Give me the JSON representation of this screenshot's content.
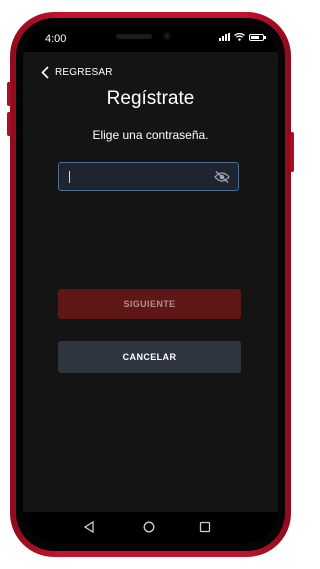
{
  "status_bar": {
    "time": "4:00",
    "battery_level": 0.7,
    "icons": [
      "signal-icon",
      "wifi-icon",
      "battery-icon"
    ]
  },
  "header": {
    "back_label": "REGRESAR",
    "back_icon": "chevron-left-icon"
  },
  "main": {
    "title": "Regístrate",
    "subtitle": "Elige una contraseña.",
    "password_field": {
      "value": "",
      "placeholder": "",
      "toggle_icon": "eye-off-icon"
    },
    "next_button_label": "SIGUIENTE",
    "cancel_button_label": "CANCELAR"
  },
  "navigation_bar": {
    "buttons": [
      "back-triangle-icon",
      "home-circle-icon",
      "recents-square-icon"
    ]
  },
  "colors": {
    "frame": "#c3142d",
    "screen_background": "#141414",
    "next_button": "#5e1616",
    "cancel_button": "#2e3540",
    "input_border": "#4b6d8e"
  }
}
